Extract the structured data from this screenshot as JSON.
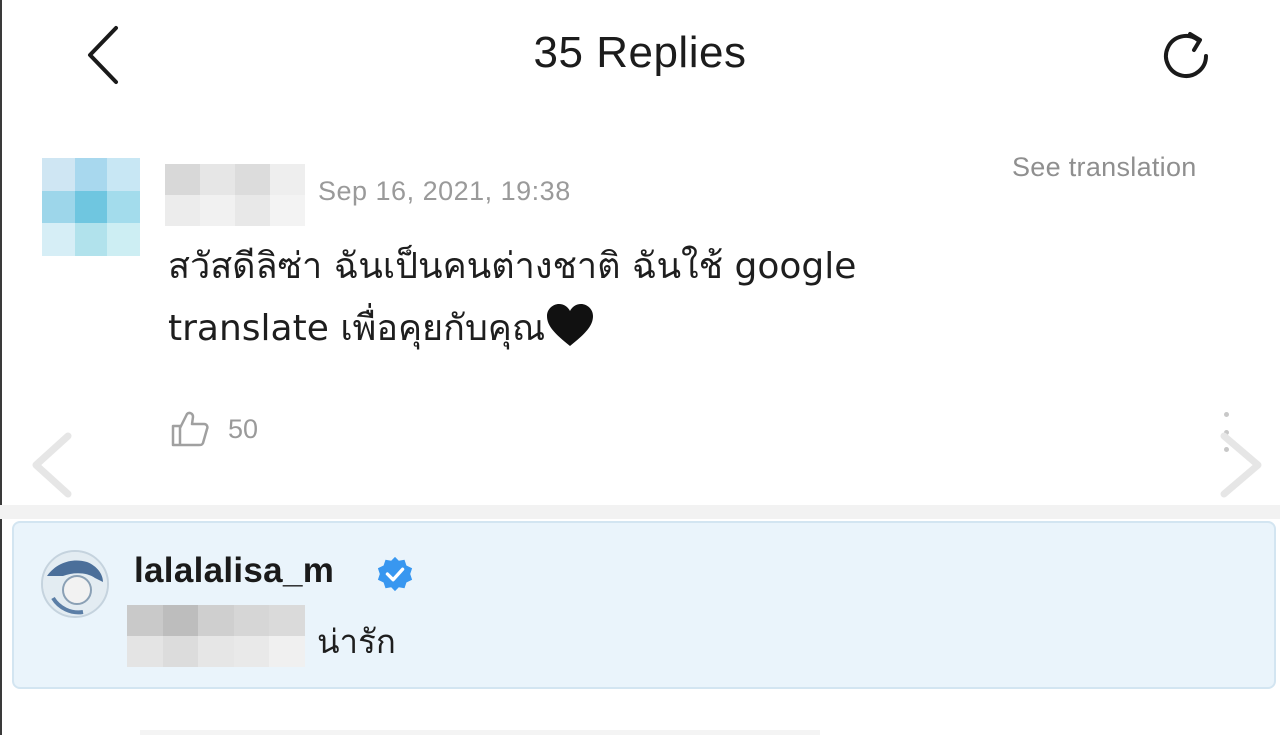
{
  "header": {
    "title": "35 Replies",
    "back_icon": "chevron-left-icon",
    "refresh_icon": "refresh-icon"
  },
  "comment": {
    "timestamp": "Sep 16, 2021, 19:38",
    "see_translation": "See translation",
    "text": "สวัสดีลิซ่า ฉันเป็นคนต่างชาติ ฉันใช้ google translate เพื่อคุยกับคุณ",
    "emoji_icon": "black-heart-icon",
    "like_count": "50",
    "like_icon": "thumbs-up-icon",
    "more_icon": "more-vertical-icon"
  },
  "reply": {
    "username": "lalalalisa_m",
    "verified_icon": "verified-badge-icon",
    "text": "น่ารัก"
  },
  "navigation": {
    "prev_icon": "arrow-left-icon",
    "next_icon": "arrow-right-icon"
  },
  "colors": {
    "reply_background": "#eaf4fb",
    "verified_blue": "#3897f0",
    "muted_text": "#9a9a9a"
  }
}
